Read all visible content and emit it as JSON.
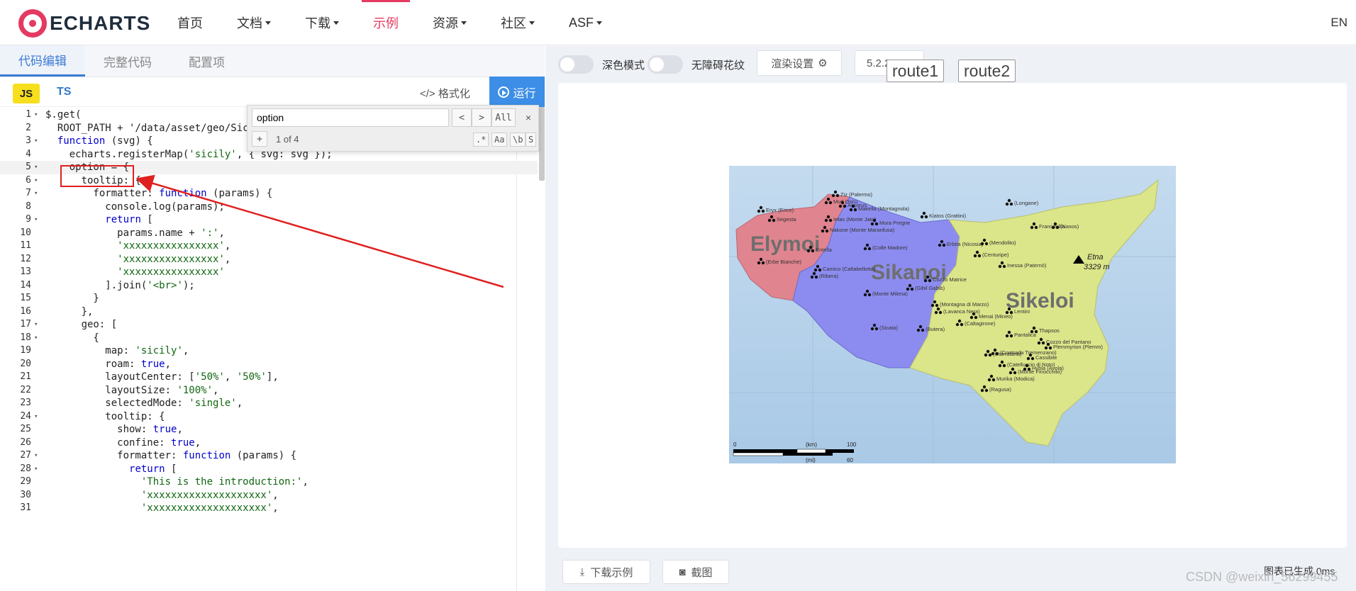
{
  "nav": {
    "logo": "ECHARTS",
    "items": [
      {
        "label": "首页",
        "caret": false,
        "active": false
      },
      {
        "label": "文档",
        "caret": true,
        "active": false
      },
      {
        "label": "下载",
        "caret": true,
        "active": false
      },
      {
        "label": "示例",
        "caret": false,
        "active": true
      },
      {
        "label": "资源",
        "caret": true,
        "active": false
      },
      {
        "label": "社区",
        "caret": true,
        "active": false
      },
      {
        "label": "ASF",
        "caret": true,
        "active": false
      }
    ],
    "lang": "EN"
  },
  "editor": {
    "tabs": [
      "代码编辑",
      "完整代码",
      "配置项"
    ],
    "js_label": "JS",
    "ts_label": "TS",
    "format_label": "格式化",
    "run_label": "运行",
    "find": {
      "value": "option",
      "prev": "<",
      "next": ">",
      "all": "All",
      "close": "✕",
      "plus": "+",
      "count": "1 of 4",
      "regex": ".*",
      "case": "Aa",
      "word": "\\b",
      "sel": "S"
    },
    "lines": [
      {
        "n": "1",
        "fold": true,
        "t": "$.get("
      },
      {
        "n": "2",
        "fold": false,
        "t": "  ROOT_PATH + '/data/asset/geo/Sic"
      },
      {
        "n": "3",
        "fold": true,
        "t": "  function (svg) {"
      },
      {
        "n": "4",
        "fold": false,
        "t": "    echarts.registerMap('sicily', { svg: svg });"
      },
      {
        "n": "5",
        "fold": true,
        "t": "    option = {"
      },
      {
        "n": "6",
        "fold": true,
        "t": "      tooltip: {"
      },
      {
        "n": "7",
        "fold": true,
        "t": "        formatter: function (params) {"
      },
      {
        "n": "8",
        "fold": false,
        "t": "          console.log(params);"
      },
      {
        "n": "9",
        "fold": true,
        "t": "          return ["
      },
      {
        "n": "10",
        "fold": false,
        "t": "            params.name + ':',"
      },
      {
        "n": "11",
        "fold": false,
        "t": "            'xxxxxxxxxxxxxxxx',"
      },
      {
        "n": "12",
        "fold": false,
        "t": "            'xxxxxxxxxxxxxxxx',"
      },
      {
        "n": "13",
        "fold": false,
        "t": "            'xxxxxxxxxxxxxxxx'"
      },
      {
        "n": "14",
        "fold": false,
        "t": "          ].join('<br>');"
      },
      {
        "n": "15",
        "fold": false,
        "t": "        }"
      },
      {
        "n": "16",
        "fold": false,
        "t": "      },"
      },
      {
        "n": "17",
        "fold": true,
        "t": "      geo: ["
      },
      {
        "n": "18",
        "fold": true,
        "t": "        {"
      },
      {
        "n": "19",
        "fold": false,
        "t": "          map: 'sicily',"
      },
      {
        "n": "20",
        "fold": false,
        "t": "          roam: true,"
      },
      {
        "n": "21",
        "fold": false,
        "t": "          layoutCenter: ['50%', '50%'],"
      },
      {
        "n": "22",
        "fold": false,
        "t": "          layoutSize: '100%',"
      },
      {
        "n": "23",
        "fold": false,
        "t": "          selectedMode: 'single',"
      },
      {
        "n": "24",
        "fold": true,
        "t": "          tooltip: {"
      },
      {
        "n": "25",
        "fold": false,
        "t": "            show: true,"
      },
      {
        "n": "26",
        "fold": false,
        "t": "            confine: true,"
      },
      {
        "n": "27",
        "fold": true,
        "t": "            formatter: function (params) {"
      },
      {
        "n": "28",
        "fold": true,
        "t": "              return ["
      },
      {
        "n": "29",
        "fold": false,
        "t": "                'This is the introduction:',"
      },
      {
        "n": "30",
        "fold": false,
        "t": "                'xxxxxxxxxxxxxxxxxxxx',"
      },
      {
        "n": "31",
        "fold": false,
        "t": "                'xxxxxxxxxxxxxxxxxxxx',"
      }
    ]
  },
  "preview": {
    "dark_mode_label": "深色模式",
    "aria_label": "无障碍花纹",
    "render_label": "渲染设置",
    "version": "5.2.2",
    "routes": [
      "route1",
      "route2"
    ],
    "download_label": "下载示例",
    "screenshot_label": "截图",
    "status": "图表已生成 0ms",
    "watermark": "CSDN @weixin_56299455"
  },
  "map": {
    "regions": [
      "Elymoi",
      "Sikanoi",
      "Sikeloi"
    ],
    "peak": "Etna",
    "peak_height": "3329 m",
    "places": [
      "Ziz (Palermo)",
      "Mud Oscu",
      "Assorus",
      "Eryx (Erice)",
      "Segesta",
      "Makella (Montagnola)",
      "Ietas (Monte Jato)",
      "Nakone (Monte Maranfusa)",
      "Mura Pregne",
      "Kiatos (Grattini)",
      "(Longane)",
      "Francavilla",
      "(Naxos)",
      "Erbita (Nicosia)",
      "(Mendolito)",
      "Entella",
      "(Colle Madore)",
      "(Erbe Bianche)",
      "Camico (Caltabellotta)",
      "(Centuripe)",
      "Inessa (Paternò)",
      "Cozzo Matrice",
      "(Ribera)",
      "(Gibil Gabib)",
      "(Monte Milena)",
      "(Montagna di Marzo)",
      "(Lavanca Nera)",
      "Menai (Mineo)",
      "Lentini",
      "(Caltagirone)",
      "(Sicata)",
      "(Butera)",
      "Pantalica",
      "Thapsos",
      "Cozzo del Pantano",
      "Plemmyrion (Plemm)",
      "(Contrada Tremenzano)",
      "(Giarratana)",
      "Cassibile",
      "(Catelluccio di Noto)",
      "Hybla (Avola)",
      "(Monte Finocchito)",
      "Murika (Modica)",
      "(Ragusa)"
    ],
    "scale_km": "(km)",
    "scale_mi": "(mi)",
    "scale_0": "0",
    "scale_100": "100",
    "scale_60": "60"
  },
  "colors": {
    "accent": "#e43961",
    "run": "#3c8ee6",
    "elymoi": "#e0848f",
    "sikanoi": "#8c8cf0",
    "sikeloi": "#dbe58a",
    "sea": "#b7d3ea"
  }
}
